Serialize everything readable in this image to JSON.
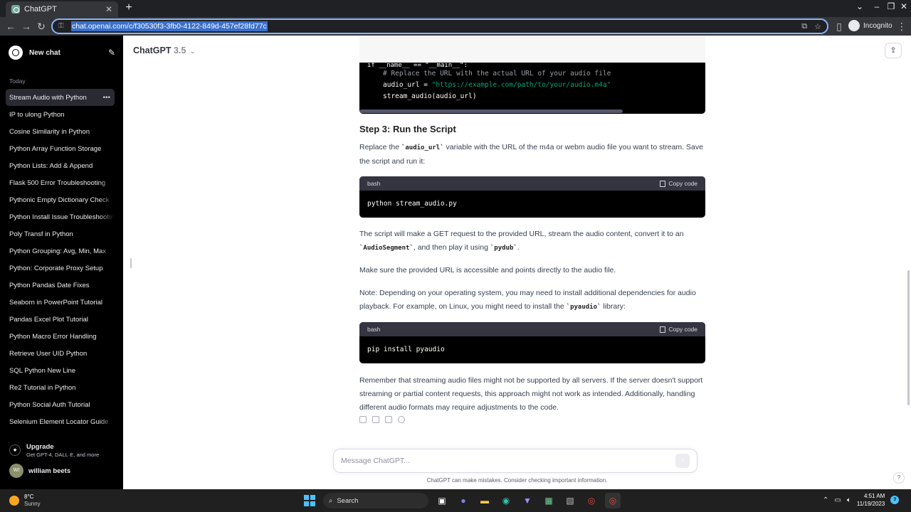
{
  "browser": {
    "tab_title": "ChatGPT",
    "url": "chat.openai.com/c/f30530f3-3fb0-4122-849d-457ef28fd77c",
    "profile": "Incognito"
  },
  "sidebar": {
    "new_chat": "New chat",
    "section": "Today",
    "items": [
      {
        "label": "Stream Audio with Python",
        "active": true
      },
      {
        "label": "IP to ulong Python"
      },
      {
        "label": "Cosine Similarity in Python"
      },
      {
        "label": "Python Array Function Storage"
      },
      {
        "label": "Python Lists: Add & Append"
      },
      {
        "label": "Flask 500 Error Troubleshooting"
      },
      {
        "label": "Pythonic Empty Dictionary Check"
      },
      {
        "label": "Python Install Issue Troubleshooting"
      },
      {
        "label": "Poly Transf in Python"
      },
      {
        "label": "Python Grouping: Avg, Min, Max"
      },
      {
        "label": "Python: Corporate Proxy Setup"
      },
      {
        "label": "Python Pandas Date Fixes"
      },
      {
        "label": "Seaborn in PowerPoint Tutorial"
      },
      {
        "label": "Pandas Excel Plot Tutorial"
      },
      {
        "label": "Python Macro Error Handling"
      },
      {
        "label": "Retrieve User UID Python"
      },
      {
        "label": "SQL Python New Line"
      },
      {
        "label": "Re2 Tutorial in Python"
      },
      {
        "label": "Python Social Auth Tutorial"
      },
      {
        "label": "Selenium Element Locator Guide"
      }
    ],
    "upgrade_title": "Upgrade",
    "upgrade_sub": "Get GPT-4, DALL·E, and more",
    "user_initials": "WI",
    "user_name": "william beets"
  },
  "header": {
    "model_name": "ChatGPT",
    "model_version": "3.5"
  },
  "message": {
    "code_top_lines": {
      "comment": "# Replace the URL with the actual URL of your audio file",
      "assign_lhs": "audio_url = ",
      "assign_str": "\"https://example.com/path/to/your/audio.m4a\"",
      "call": "stream_audio(audio_url)"
    },
    "step_heading": "Step 3: Run the Script",
    "p1_a": "Replace the ",
    "p1_code": "`audio_url`",
    "p1_b": " variable with the URL of the m4a or webm audio file you want to stream. Save the script and run it:",
    "code1_lang": "bash",
    "copy_label": "Copy code",
    "code1_body": "python stream_audio.py",
    "p2_a": "The script will make a GET request to the provided URL, stream the audio content, convert it to an ",
    "p2_code1": "`AudioSegment`",
    "p2_b": ", and then play it using ",
    "p2_code2": "`pydub`",
    "p2_c": ".",
    "p3": "Make sure the provided URL is accessible and points directly to the audio file.",
    "p4_a": "Note: Depending on your operating system, you may need to install additional dependencies for audio playback. For example, on Linux, you might need to install the ",
    "p4_code": "`pyaudio`",
    "p4_b": " library:",
    "code2_lang": "bash",
    "code2_body": "pip install pyaudio",
    "p5": "Remember that streaming audio files might not be supported by all servers. If the server doesn't support streaming or partial content requests, this approach might not work as intended. Additionally, handling different audio formats may require adjustments to the code."
  },
  "composer": {
    "placeholder": "Message ChatGPT..."
  },
  "disclaimer": "ChatGPT can make mistakes. Consider checking important information.",
  "taskbar": {
    "temp": "8°C",
    "condition": "Sunny",
    "search": "Search",
    "time": "4:51 AM",
    "date": "11/19/2023",
    "notif_count": "9"
  }
}
